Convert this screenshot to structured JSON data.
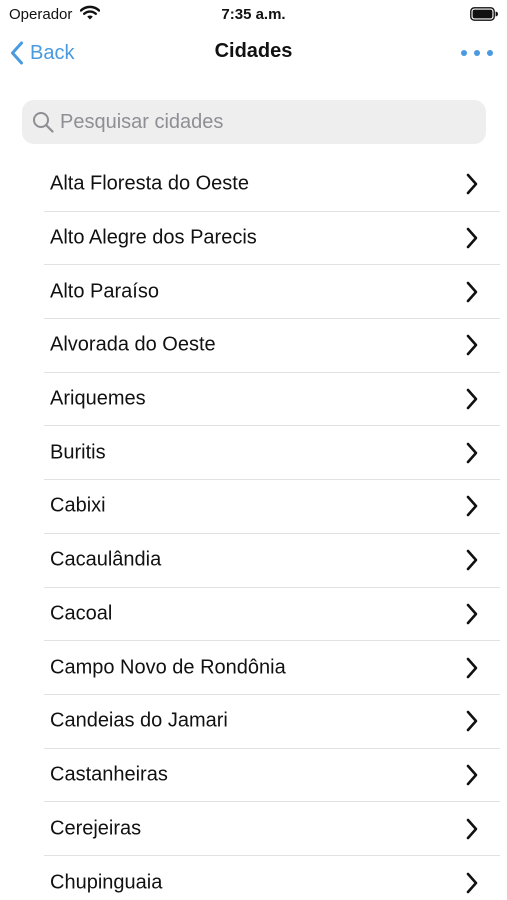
{
  "status_bar": {
    "carrier": "Operador",
    "time": "7:35 a.m.",
    "icons": [
      "wifi-icon",
      "battery-icon"
    ]
  },
  "nav": {
    "back_label": "Back",
    "title": "Cidades",
    "more_icon": "more-horizontal-icon",
    "accent_color": "#4a9ae0"
  },
  "search": {
    "placeholder": "Pesquisar cidades",
    "value": ""
  },
  "cities": [
    "Alta Floresta do Oeste",
    "Alto Alegre dos Parecis",
    "Alto Paraíso",
    "Alvorada do Oeste",
    "Ariquemes",
    "Buritis",
    "Cabixi",
    "Cacaulândia",
    "Cacoal",
    "Campo Novo de Rondônia",
    "Candeias do Jamari",
    "Castanheiras",
    "Cerejeiras",
    "Chupinguaia"
  ]
}
